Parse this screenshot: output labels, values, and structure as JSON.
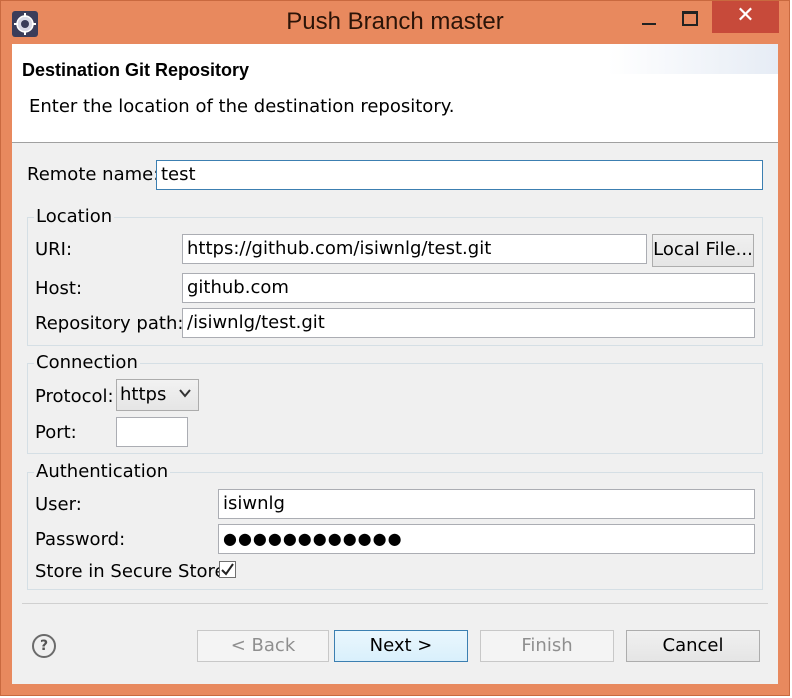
{
  "window": {
    "title": "Push Branch master"
  },
  "header": {
    "title": "Destination Git Repository",
    "description": "Enter the location of the destination repository."
  },
  "remote": {
    "label": "Remote name:",
    "value": "test"
  },
  "location": {
    "group_label": "Location",
    "uri_label": "URI:",
    "uri_value": "https://github.com/isiwnlg/test.git",
    "local_file_button": "Local File...",
    "host_label": "Host:",
    "host_value": "github.com",
    "path_label": "Repository path:",
    "path_value": "/isiwnlg/test.git"
  },
  "connection": {
    "group_label": "Connection",
    "protocol_label": "Protocol:",
    "protocol_value": "https",
    "port_label": "Port:",
    "port_value": ""
  },
  "authentication": {
    "group_label": "Authentication",
    "user_label": "User:",
    "user_value": "isiwnlg",
    "password_label": "Password:",
    "password_value": "●●●●●●●●●●●●",
    "store_label": "Store in Secure Store",
    "store_checked": true
  },
  "buttons": {
    "help": "?",
    "back": "< Back",
    "next": "Next >",
    "finish": "Finish",
    "cancel": "Cancel"
  },
  "icons": {
    "app": "eclipse-app-icon",
    "minimize": "minimize-icon",
    "maximize": "maximize-icon",
    "close": "close-icon",
    "close_glyph": "✕",
    "dropdown": "chevron-down-icon",
    "check": "checkmark-icon",
    "help": "help-icon"
  },
  "colors": {
    "titlebar": "#e8895e",
    "close_button": "#c74a3a",
    "focus_border": "#3c7fb1",
    "dialog_bg": "#f0f0f0"
  }
}
